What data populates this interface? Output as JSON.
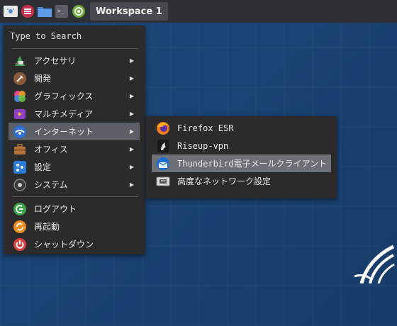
{
  "taskbar": {
    "workspace_label": "Workspace 1",
    "icons": [
      "whisker-menu-icon",
      "app-menu-icon",
      "file-manager-icon",
      "terminal-icon",
      "settings-icon"
    ]
  },
  "menu": {
    "search_placeholder": "Type to Search",
    "categories": [
      {
        "label": "アクセサリ",
        "icon": "accessories-icon",
        "color": "#3fa34d"
      },
      {
        "label": "開発",
        "icon": "development-icon",
        "color": "#8a5a3a"
      },
      {
        "label": "グラフィックス",
        "icon": "graphics-icon",
        "color": "#e24a8d"
      },
      {
        "label": "マルチメディア",
        "icon": "multimedia-icon",
        "color": "#8f3fc4"
      },
      {
        "label": "インターネット",
        "icon": "internet-icon",
        "color": "#2f6fd1"
      },
      {
        "label": "オフィス",
        "icon": "office-icon",
        "color": "#b5743a"
      },
      {
        "label": "設定",
        "icon": "settings-icon",
        "color": "#2a7ad6"
      },
      {
        "label": "システム",
        "icon": "system-icon",
        "color": "#444"
      }
    ],
    "actions": [
      {
        "label": "ログアウト",
        "icon": "logout-icon",
        "color": "#3aa546"
      },
      {
        "label": "再起動",
        "icon": "restart-icon",
        "color": "#f08a1a"
      },
      {
        "label": "シャットダウン",
        "icon": "shutdown-icon",
        "color": "#d94040"
      }
    ]
  },
  "submenu": {
    "items": [
      {
        "label": "Firefox ESR",
        "icon": "firefox-icon"
      },
      {
        "label": "Riseup-vpn",
        "icon": "riseup-vpn-icon"
      },
      {
        "label": "Thunderbird電子メールクライアント",
        "icon": "thunderbird-icon"
      },
      {
        "label": "高度なネットワーク設定",
        "icon": "network-settings-icon"
      }
    ]
  },
  "colors": {
    "taskbar_bg": "#2d3035",
    "menu_bg": "#2b2b2b",
    "highlight": "#5c5f66",
    "desktop_bg": "#1a4272"
  }
}
